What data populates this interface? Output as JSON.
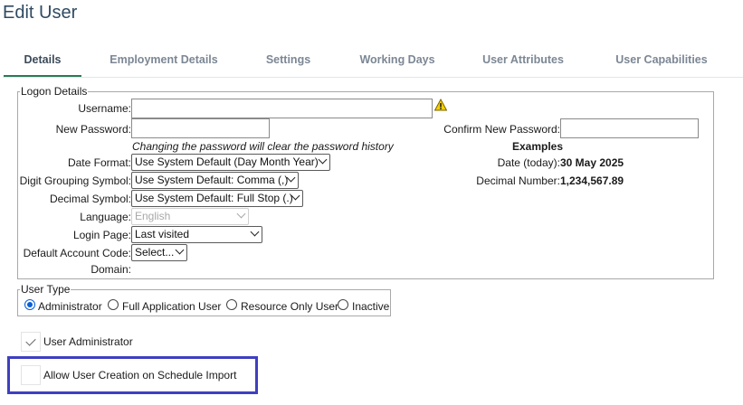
{
  "title": "Edit User",
  "tabs": [
    {
      "label": "Details"
    },
    {
      "label": "Employment Details"
    },
    {
      "label": "Settings"
    },
    {
      "label": "Working Days"
    },
    {
      "label": "User Attributes"
    },
    {
      "label": "User Capabilities"
    }
  ],
  "logon": {
    "legend": "Logon Details",
    "username_label": "Username:",
    "username_value": "",
    "new_password_label": "New Password:",
    "confirm_password_label": "Confirm New Password:",
    "password_note": "Changing the password will clear the password history",
    "date_format_label": "Date Format:",
    "date_format_value": "Use System Default (Day Month Year)",
    "digit_grouping_label": "Digit Grouping Symbol:",
    "digit_grouping_value": "Use System Default: Comma (,)",
    "decimal_symbol_label": "Decimal Symbol:",
    "decimal_symbol_value": "Use System Default: Full Stop (.)",
    "language_label": "Language:",
    "language_value": "English",
    "login_page_label": "Login Page:",
    "login_page_value": "Last visited",
    "default_account_label": "Default Account Code:",
    "default_account_value": "Select...",
    "domain_label": "Domain:",
    "examples_heading": "Examples",
    "date_today_label": "Date (today):",
    "date_today_value": "30 May 2025",
    "decimal_number_label": "Decimal Number:",
    "decimal_number_value": "1,234,567.89"
  },
  "user_type": {
    "legend": "User Type",
    "options": [
      "Administrator",
      "Full Application User",
      "Resource Only User",
      "Inactive"
    ],
    "selected": "Administrator"
  },
  "checkboxes": {
    "user_admin_label": "User Administrator",
    "user_admin_checked": true,
    "allow_creation_label": "Allow User Creation on Schedule Import",
    "allow_creation_checked": false
  },
  "colors": {
    "active_tab_underline": "#2a7a55",
    "highlight_border": "#3f3fc0",
    "title": "#2f4a62"
  }
}
